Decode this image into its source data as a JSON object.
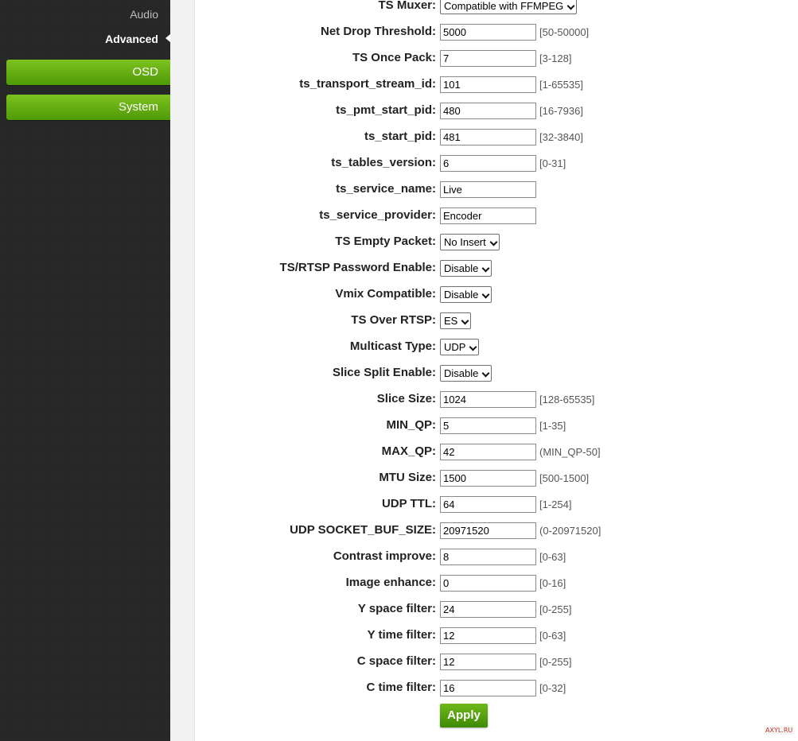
{
  "sidebar": {
    "sub_items": [
      {
        "label": "Audio",
        "active": false
      },
      {
        "label": "Advanced",
        "active": true
      }
    ],
    "menu_buttons": [
      {
        "label": "OSD"
      },
      {
        "label": "System"
      }
    ]
  },
  "form": {
    "fields": [
      {
        "label": "TS Muxer:",
        "type": "select",
        "value": "Compatible with FFMPEG",
        "range": ""
      },
      {
        "label": "Net Drop Threshold:",
        "type": "text",
        "value": "5000",
        "range": "[50-50000]"
      },
      {
        "label": "TS Once Pack:",
        "type": "text",
        "value": "7",
        "range": "[3-128]"
      },
      {
        "label": "ts_transport_stream_id:",
        "type": "text",
        "value": "101",
        "range": "[1-65535]"
      },
      {
        "label": "ts_pmt_start_pid:",
        "type": "text",
        "value": "480",
        "range": "[16-7936]"
      },
      {
        "label": "ts_start_pid:",
        "type": "text",
        "value": "481",
        "range": "[32-3840]"
      },
      {
        "label": "ts_tables_version:",
        "type": "text",
        "value": "6",
        "range": "[0-31]"
      },
      {
        "label": "ts_service_name:",
        "type": "text",
        "value": "Live",
        "range": ""
      },
      {
        "label": "ts_service_provider:",
        "type": "text",
        "value": "Encoder",
        "range": ""
      },
      {
        "label": "TS Empty Packet:",
        "type": "select",
        "value": "No Insert",
        "range": ""
      },
      {
        "label": "TS/RTSP Password Enable:",
        "type": "select",
        "value": "Disable",
        "range": ""
      },
      {
        "label": "Vmix Compatible:",
        "type": "select",
        "value": "Disable",
        "range": ""
      },
      {
        "label": "TS Over RTSP:",
        "type": "select",
        "value": "ES",
        "range": ""
      },
      {
        "label": "Multicast Type:",
        "type": "select",
        "value": "UDP",
        "range": ""
      },
      {
        "label": "Slice Split Enable:",
        "type": "select",
        "value": "Disable",
        "range": ""
      },
      {
        "label": "Slice Size:",
        "type": "text",
        "value": "1024",
        "range": "[128-65535]"
      },
      {
        "label": "MIN_QP:",
        "type": "text",
        "value": "5",
        "range": "[1-35]"
      },
      {
        "label": "MAX_QP:",
        "type": "text",
        "value": "42",
        "range": "(MIN_QP-50]"
      },
      {
        "label": "MTU Size:",
        "type": "text",
        "value": "1500",
        "range": "[500-1500]"
      },
      {
        "label": "UDP TTL:",
        "type": "text",
        "value": "64",
        "range": "[1-254]"
      },
      {
        "label": "UDP SOCKET_BUF_SIZE:",
        "type": "text",
        "value": "20971520",
        "range": "(0-20971520]"
      },
      {
        "label": "Contrast improve:",
        "type": "text",
        "value": "8",
        "range": "[0-63]"
      },
      {
        "label": "Image enhance:",
        "type": "text",
        "value": "0",
        "range": "[0-16]"
      },
      {
        "label": "Y space filter:",
        "type": "text",
        "value": "24",
        "range": "[0-255]"
      },
      {
        "label": "Y time filter:",
        "type": "text",
        "value": "12",
        "range": "[0-63]"
      },
      {
        "label": "C space filter:",
        "type": "text",
        "value": "12",
        "range": "[0-255]"
      },
      {
        "label": "C time filter:",
        "type": "text",
        "value": "16",
        "range": "[0-32]"
      }
    ],
    "apply_label": "Apply"
  },
  "watermark": "AXYL.RU",
  "colors": {
    "sidebar_bg": "#262626",
    "menu_green": "#5ea90f",
    "apply_green": "#4e9a0c"
  }
}
